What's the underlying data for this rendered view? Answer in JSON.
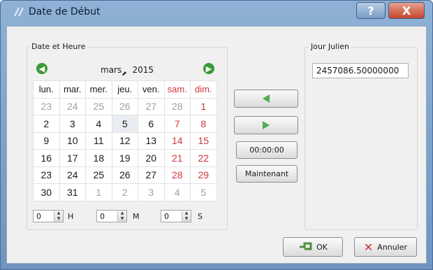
{
  "window": {
    "title": "Date de Début",
    "help_label": "?",
    "close_label": "X"
  },
  "date_group": {
    "title": "Date et Heure",
    "month": "mars",
    "year": "2015",
    "weekdays": [
      "lun.",
      "mar.",
      "mer.",
      "jeu.",
      "ven.",
      "sam.",
      "dim."
    ],
    "weeks": [
      [
        "23",
        "24",
        "25",
        "26",
        "27",
        "28",
        "1"
      ],
      [
        "2",
        "3",
        "4",
        "5",
        "6",
        "7",
        "8"
      ],
      [
        "9",
        "10",
        "11",
        "12",
        "13",
        "14",
        "15"
      ],
      [
        "16",
        "17",
        "18",
        "19",
        "20",
        "21",
        "22"
      ],
      [
        "23",
        "24",
        "25",
        "26",
        "27",
        "28",
        "29"
      ],
      [
        "30",
        "31",
        "1",
        "2",
        "3",
        "4",
        "5"
      ]
    ],
    "selected_day": "5",
    "hour": {
      "value": "0",
      "label": "H"
    },
    "minute": {
      "value": "0",
      "label": "M"
    },
    "second": {
      "value": "0",
      "label": "S"
    }
  },
  "middle_buttons": {
    "time_label": "00:00:00",
    "now_label": "Maintenant"
  },
  "julian_group": {
    "title": "Jour Julien",
    "value": "2457086.50000000"
  },
  "footer": {
    "ok_label": "OK",
    "cancel_label": "Annuler"
  },
  "colors": {
    "weekend": "#d0363c",
    "outside_month": "#a0a0a0",
    "nav_arrow": "#3a9a38"
  }
}
